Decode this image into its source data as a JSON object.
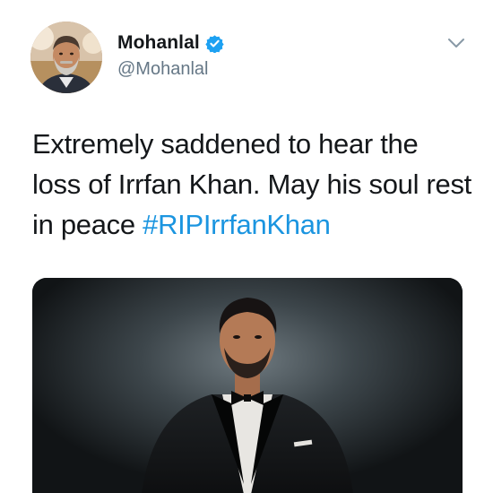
{
  "tweet": {
    "author": {
      "display_name": "Mohanlal",
      "handle": "@Mohanlal",
      "verified": true
    },
    "text_parts": [
      {
        "text": "Extremely saddened to hear the loss of Irrfan Khan. May his soul rest in peace "
      },
      {
        "text": "#RIPIrrfanKhan",
        "hashtag": true
      }
    ],
    "media": {
      "type": "photo"
    }
  },
  "colors": {
    "text": "#14171a",
    "secondary": "#657786",
    "link": "#1b95e0",
    "verified": "#1da1f2"
  },
  "icons": {
    "verified": "verified-badge-icon",
    "menu": "chevron-down-icon"
  }
}
